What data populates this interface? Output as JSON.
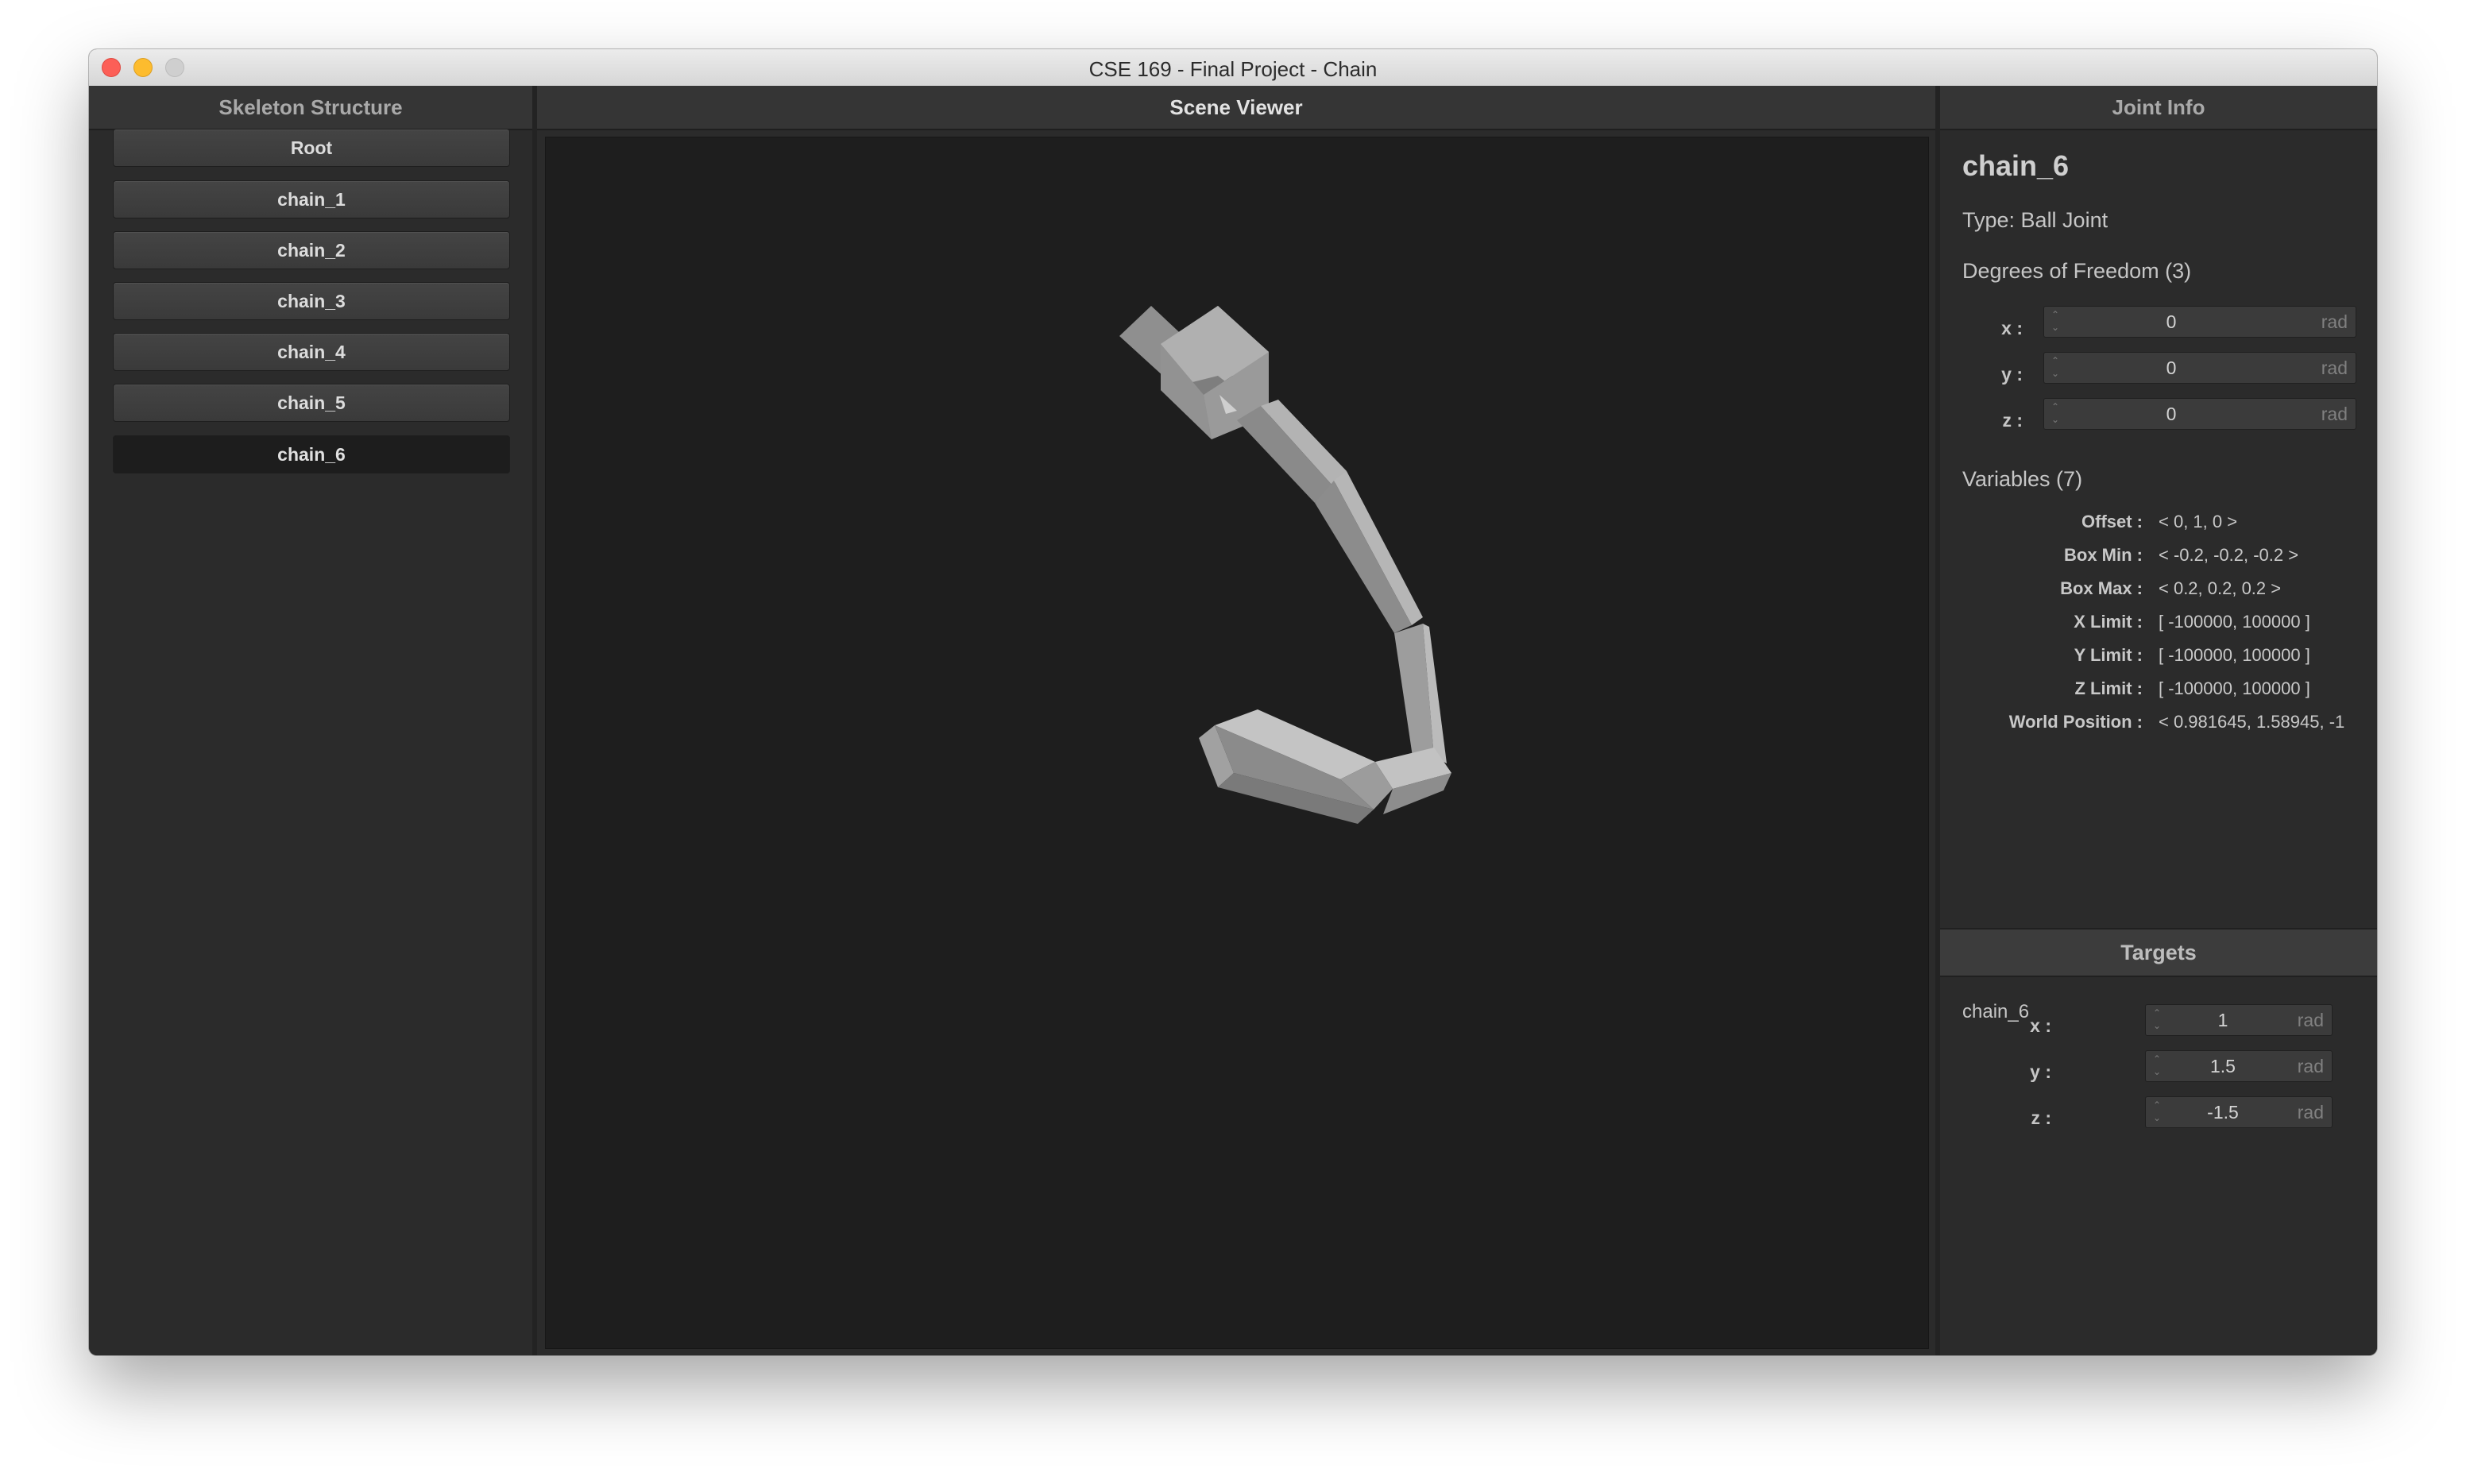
{
  "window": {
    "title": "CSE 169 - Final Project - Chain"
  },
  "skeleton_panel": {
    "header": "Skeleton Structure",
    "joints": [
      "Root",
      "chain_1",
      "chain_2",
      "chain_3",
      "chain_4",
      "chain_5",
      "chain_6"
    ],
    "selected": "chain_6"
  },
  "scene_panel": {
    "header": "Scene Viewer"
  },
  "joint_info": {
    "header": "Joint Info",
    "name": "chain_6",
    "type": "Type: Ball Joint",
    "dof_heading": "Degrees of Freedom (3)",
    "dofs": [
      {
        "label": "x :",
        "value": "0",
        "unit": "rad"
      },
      {
        "label": "y :",
        "value": "0",
        "unit": "rad"
      },
      {
        "label": "z :",
        "value": "0",
        "unit": "rad"
      }
    ],
    "variables_heading": "Variables (7)",
    "variables": [
      {
        "label": "Offset :",
        "value": "< 0, 1, 0 >"
      },
      {
        "label": "Box Min :",
        "value": "< -0.2, -0.2, -0.2 >"
      },
      {
        "label": "Box Max :",
        "value": "< 0.2, 0.2, 0.2 >"
      },
      {
        "label": "X Limit :",
        "value": "[ -100000, 100000 ]"
      },
      {
        "label": "Y Limit :",
        "value": "[ -100000, 100000 ]"
      },
      {
        "label": "Z Limit :",
        "value": "[ -100000, 100000 ]"
      },
      {
        "label": "World Position :",
        "value": "< 0.981645, 1.58945, -1"
      }
    ]
  },
  "targets": {
    "header": "Targets",
    "name": "chain_6",
    "coords": [
      {
        "label": "x :",
        "value": "1",
        "unit": "rad"
      },
      {
        "label": "y :",
        "value": "1.5",
        "unit": "rad"
      },
      {
        "label": "z :",
        "value": "-1.5",
        "unit": "rad"
      }
    ]
  }
}
